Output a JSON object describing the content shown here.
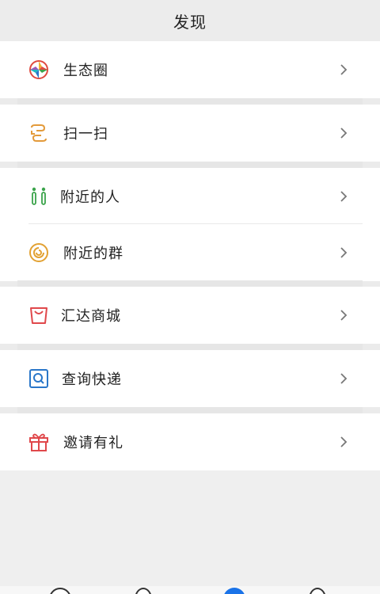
{
  "header": {
    "title": "发现"
  },
  "items": [
    {
      "label": "生态圈"
    },
    {
      "label": "扫一扫"
    },
    {
      "label": "附近的人"
    },
    {
      "label": "附近的群"
    },
    {
      "label": "汇达商城"
    },
    {
      "label": "查询快递"
    },
    {
      "label": "邀请有礼"
    }
  ],
  "colors": {
    "scan_icon": "#e39a3a",
    "nearby_people_icon": "#3aa34a",
    "nearby_group_icon": "#e2a132",
    "mall_icon": "#e0484b",
    "express_icon": "#2a77c9",
    "gift_icon": "#e0484b",
    "tab_active": "#1a73e8"
  }
}
